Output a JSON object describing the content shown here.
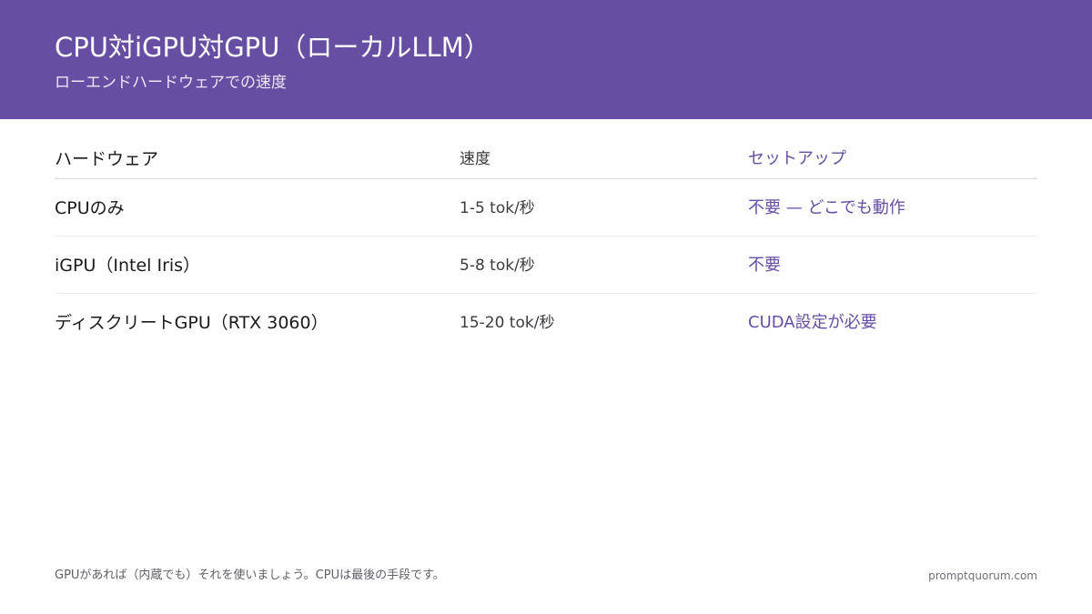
{
  "header": {
    "title": "CPU対iGPU対GPU（ローカルLLM）",
    "subtitle": "ローエンドハードウェアでの速度"
  },
  "table": {
    "columns": [
      "ハードウェア",
      "速度",
      "セットアップ"
    ],
    "rows": [
      {
        "hardware": "CPUのみ",
        "speed": "1-5 tok/秒",
        "setup": "不要 — どこでも動作"
      },
      {
        "hardware": "iGPU（Intel Iris）",
        "speed": "5-8 tok/秒",
        "setup": "不要"
      },
      {
        "hardware": "ディスクリートGPU（RTX 3060）",
        "speed": "15-20 tok/秒",
        "setup": "CUDA設定が必要"
      }
    ]
  },
  "footer": {
    "note": "GPUがあれば（内蔵でも）それを使いましょう。CPUは最後の手段です。",
    "site": "promptquorum.com"
  },
  "colors": {
    "header_bg": "#664ea3",
    "accent": "#664ea3"
  }
}
